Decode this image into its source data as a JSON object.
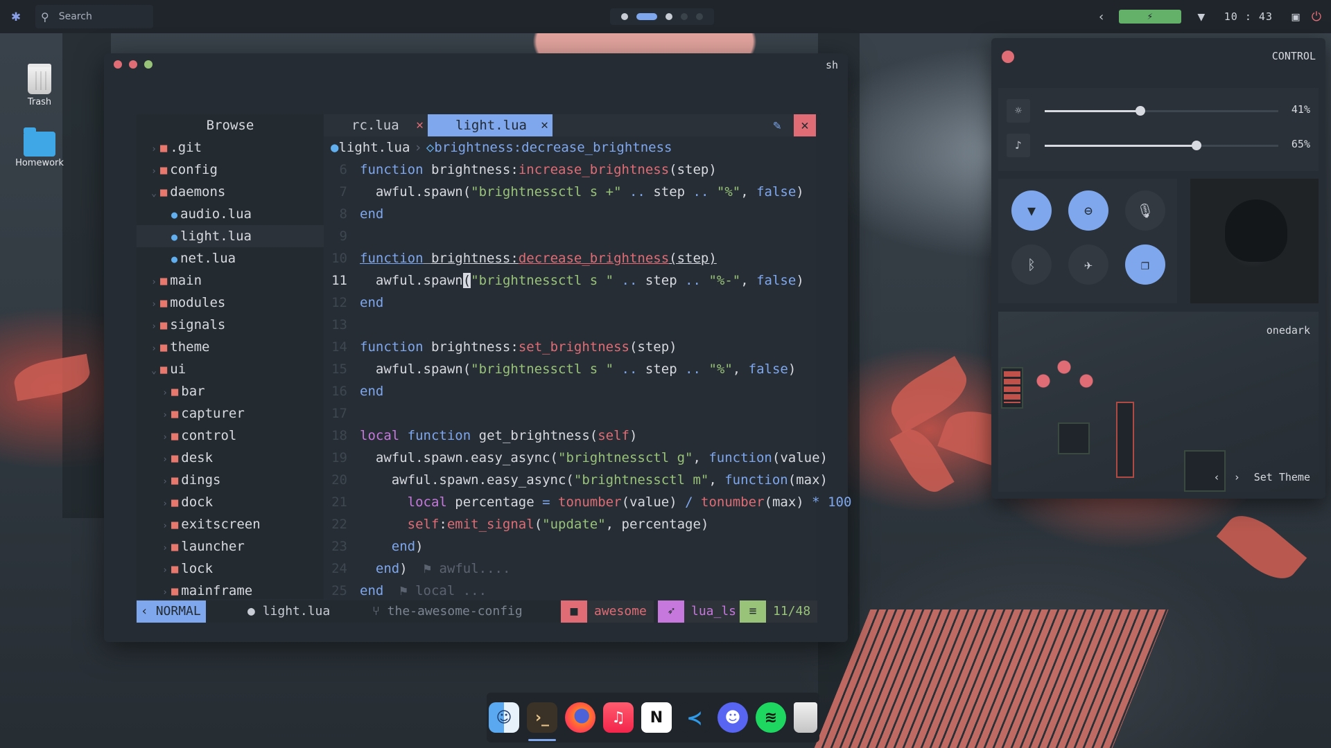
{
  "topbar": {
    "search_placeholder": "Search",
    "time": "10 : 43",
    "workspaces": [
      "1",
      "2",
      "3",
      "4",
      "5"
    ],
    "active_workspace": 2,
    "battery_glyph": "⚡"
  },
  "desktop": {
    "icons": [
      {
        "label": "Trash",
        "icon": "trash-icon"
      },
      {
        "label": "Homework",
        "icon": "folder-icon"
      }
    ]
  },
  "terminal": {
    "title": "sh",
    "tree": {
      "title": "Browse",
      "items": [
        {
          "name": ".git",
          "type": "folder",
          "depth": 0,
          "open": false
        },
        {
          "name": "config",
          "type": "folder",
          "depth": 0,
          "open": false
        },
        {
          "name": "daemons",
          "type": "folder",
          "depth": 0,
          "open": true
        },
        {
          "name": "audio.lua",
          "type": "file",
          "depth": 1
        },
        {
          "name": "light.lua",
          "type": "file",
          "depth": 1,
          "selected": true
        },
        {
          "name": "net.lua",
          "type": "file",
          "depth": 1
        },
        {
          "name": "main",
          "type": "folder",
          "depth": 0,
          "open": false
        },
        {
          "name": "modules",
          "type": "folder",
          "depth": 0,
          "open": false
        },
        {
          "name": "signals",
          "type": "folder",
          "depth": 0,
          "open": false
        },
        {
          "name": "theme",
          "type": "folder",
          "depth": 0,
          "open": false
        },
        {
          "name": "ui",
          "type": "folder",
          "depth": 0,
          "open": true
        },
        {
          "name": "bar",
          "type": "folder",
          "depth": 1,
          "open": false
        },
        {
          "name": "capturer",
          "type": "folder",
          "depth": 1,
          "open": false
        },
        {
          "name": "control",
          "type": "folder",
          "depth": 1,
          "open": false
        },
        {
          "name": "desk",
          "type": "folder",
          "depth": 1,
          "open": false
        },
        {
          "name": "dings",
          "type": "folder",
          "depth": 1,
          "open": false
        },
        {
          "name": "dock",
          "type": "folder",
          "depth": 1,
          "open": false
        },
        {
          "name": "exitscreen",
          "type": "folder",
          "depth": 1,
          "open": false
        },
        {
          "name": "launcher",
          "type": "folder",
          "depth": 1,
          "open": false
        },
        {
          "name": "lock",
          "type": "folder",
          "depth": 1,
          "open": false
        },
        {
          "name": "mainframe",
          "type": "folder",
          "depth": 1,
          "open": false
        }
      ]
    },
    "tabs": [
      {
        "label": "rc.lua",
        "active": false
      },
      {
        "label": "light.lua",
        "active": true
      }
    ],
    "breadcrumb": {
      "file": "light.lua",
      "symbol": "brightness:decrease_brightness"
    },
    "status": {
      "mode": "NORMAL",
      "file": "light.lua",
      "branch": "the-awesome-config",
      "project": "awesome",
      "lsp": "lua_ls",
      "position": "11/48"
    }
  },
  "control": {
    "title": "CONTROL",
    "brightness": {
      "value": 41,
      "label": "41%"
    },
    "volume": {
      "value": 65,
      "label": "65%"
    },
    "toggles": [
      {
        "name": "wifi",
        "icon": "wifi-icon",
        "on": true
      },
      {
        "name": "dnd",
        "icon": "minus-circle-icon",
        "on": true
      },
      {
        "name": "mic",
        "icon": "mic-off-icon",
        "on": false
      },
      {
        "name": "bluetooth",
        "icon": "bluetooth-off-icon",
        "on": false
      },
      {
        "name": "airplane",
        "icon": "airplane-off-icon",
        "on": false
      },
      {
        "name": "screenshot",
        "icon": "copy-icon",
        "on": true
      }
    ],
    "theme": {
      "name": "onedark",
      "action": "Set Theme"
    }
  },
  "dock": {
    "apps": [
      "Finder",
      "Terminal",
      "Firefox",
      "Music",
      "Notion",
      "VS Code",
      "Discord",
      "Spotify",
      "Trash"
    ],
    "active_app": "Terminal"
  }
}
